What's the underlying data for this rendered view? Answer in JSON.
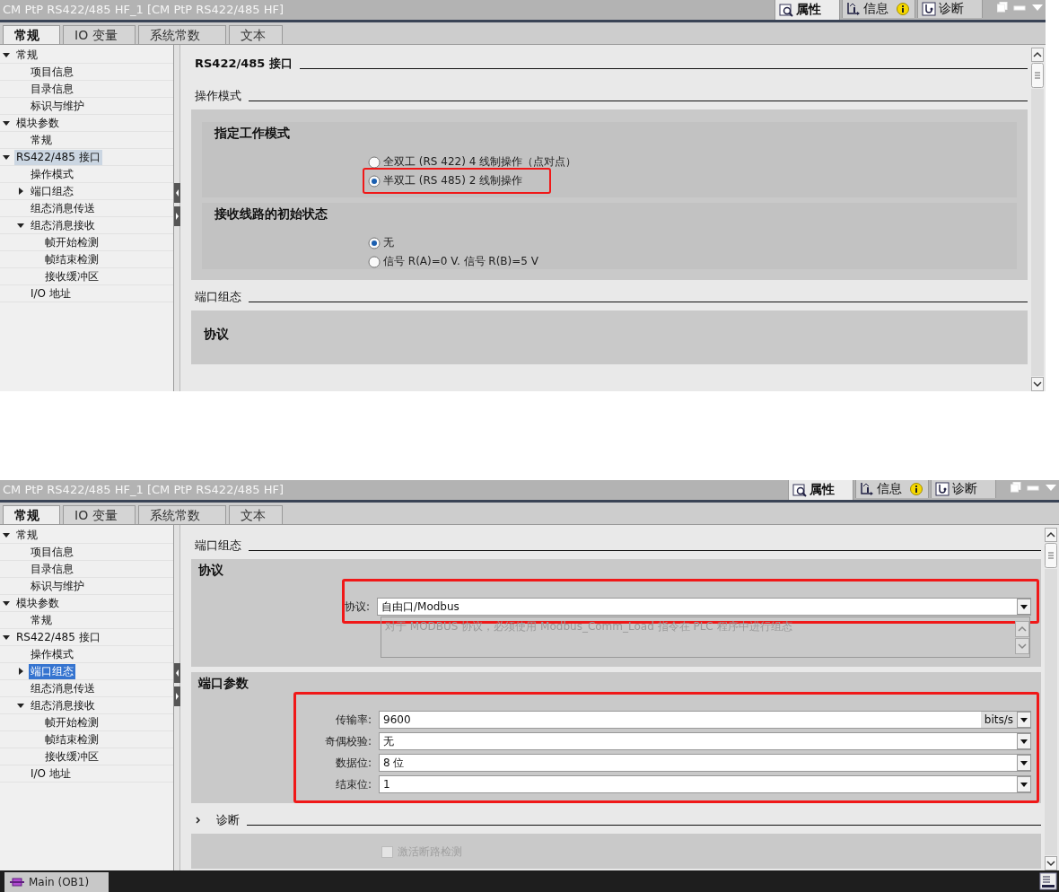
{
  "panels": [
    {
      "title": "CM PtP RS422/485 HF_1 [CM PtP RS422/485 HF]",
      "view_tabs": [
        {
          "label": "属性",
          "selected": true,
          "kind": "properties",
          "alert": false
        },
        {
          "label": "信息",
          "selected": false,
          "kind": "info",
          "alert": true
        },
        {
          "label": "诊断",
          "selected": false,
          "kind": "diagnostics",
          "alert": false
        }
      ],
      "tabs": [
        {
          "label": "常规",
          "selected": true
        },
        {
          "label": "IO 变量",
          "selected": false
        },
        {
          "label": "系统常数",
          "selected": false
        },
        {
          "label": "文本",
          "selected": false
        }
      ],
      "tree_focused": false,
      "tree": [
        {
          "label": "常规",
          "selected": false,
          "expanded": true,
          "children": [
            {
              "label": "项目信息",
              "selected": false
            },
            {
              "label": "目录信息",
              "selected": false
            },
            {
              "label": "标识与维护",
              "selected": false
            }
          ]
        },
        {
          "label": "模块参数",
          "selected": false,
          "expanded": true,
          "children": [
            {
              "label": "常规",
              "selected": false
            }
          ]
        },
        {
          "label": "RS422/485 接口",
          "selected": true,
          "expanded": true,
          "children": [
            {
              "label": "操作模式",
              "selected": false
            },
            {
              "label": "端口组态",
              "selected": false,
              "expanded": false
            },
            {
              "label": "组态消息传送",
              "selected": false
            },
            {
              "label": "组态消息接收",
              "selected": false,
              "expanded": true,
              "children": [
                {
                  "label": "帧开始检测",
                  "selected": false
                },
                {
                  "label": "帧结束检测",
                  "selected": false
                },
                {
                  "label": "接收缓冲区",
                  "selected": false
                }
              ]
            },
            {
              "label": "I/O 地址",
              "selected": false
            }
          ]
        }
      ],
      "content": [
        {
          "kind": "heading",
          "text": "RS422/485 接口"
        },
        {
          "kind": "section",
          "text": "操作模式",
          "groups": [
            {
              "title": "指定工作模式",
              "options": [
                {
                  "label": "全双工 (RS 422) 4 线制操作（点对点）",
                  "selected": false
                },
                {
                  "label": "半双工 (RS 485) 2 线制操作",
                  "selected": true,
                  "highlighted": true
                }
              ]
            },
            {
              "title": "接收线路的初始状态",
              "options": [
                {
                  "label": "无",
                  "selected": true
                },
                {
                  "label": "信号 R(A)=0 V. 信号 R(B)=5 V",
                  "selected": false
                }
              ]
            }
          ]
        },
        {
          "kind": "section",
          "text": "端口组态",
          "groups": [
            {
              "title": "协议"
            }
          ]
        }
      ]
    },
    {
      "title": "CM PtP RS422/485 HF_1 [CM PtP RS422/485 HF]",
      "view_tabs": [
        {
          "label": "属性",
          "selected": true,
          "kind": "properties",
          "alert": false
        },
        {
          "label": "信息",
          "selected": false,
          "kind": "info",
          "alert": true
        },
        {
          "label": "诊断",
          "selected": false,
          "kind": "diagnostics",
          "alert": false
        }
      ],
      "tabs": [
        {
          "label": "常规",
          "selected": true
        },
        {
          "label": "IO 变量",
          "selected": false
        },
        {
          "label": "系统常数",
          "selected": false
        },
        {
          "label": "文本",
          "selected": false
        }
      ],
      "tree_focused": true,
      "tree": [
        {
          "label": "常规",
          "selected": false,
          "expanded": true,
          "children": [
            {
              "label": "项目信息",
              "selected": false
            },
            {
              "label": "目录信息",
              "selected": false
            },
            {
              "label": "标识与维护",
              "selected": false
            }
          ]
        },
        {
          "label": "模块参数",
          "selected": false,
          "expanded": true,
          "children": [
            {
              "label": "常规",
              "selected": false
            }
          ]
        },
        {
          "label": "RS422/485 接口",
          "selected": false,
          "expanded": true,
          "children": [
            {
              "label": "操作模式",
              "selected": false
            },
            {
              "label": "端口组态",
              "selected": true,
              "expanded": false
            },
            {
              "label": "组态消息传送",
              "selected": false
            },
            {
              "label": "组态消息接收",
              "selected": false,
              "expanded": true,
              "children": [
                {
                  "label": "帧开始检测",
                  "selected": false
                },
                {
                  "label": "帧结束检测",
                  "selected": false
                },
                {
                  "label": "接收缓冲区",
                  "selected": false
                }
              ]
            },
            {
              "label": "I/O 地址",
              "selected": false
            }
          ]
        }
      ],
      "content": [
        {
          "kind": "section",
          "text": "端口组态",
          "groups": [
            {
              "title": "协议",
              "highlighted": true,
              "fields": [
                {
                  "label": "协议:",
                  "value": "自由口/Modbus"
                }
              ],
              "note": "对于 MODBUS 协议，必须使用 Modbus_Comm_Load 指令在 PLC 程序中进行组态"
            },
            {
              "title": "端口参数",
              "highlighted": true,
              "fields": [
                {
                  "label": "传输率:",
                  "value": "9600",
                  "unit": "bits/s"
                },
                {
                  "label": "奇偶校验:",
                  "value": "无"
                },
                {
                  "label": "数据位:",
                  "value": "8 位"
                },
                {
                  "label": "结束位:",
                  "value": "1"
                }
              ]
            }
          ]
        },
        {
          "kind": "section",
          "text": "诊断",
          "collapsible": true,
          "groups": [
            {
              "checks": [
                {
                  "label": "激活断路检测",
                  "checked": false,
                  "disabled": true
                }
              ]
            }
          ]
        }
      ],
      "taskbar": {
        "items": [
          {
            "label": "Main (OB1)"
          }
        ]
      }
    }
  ]
}
